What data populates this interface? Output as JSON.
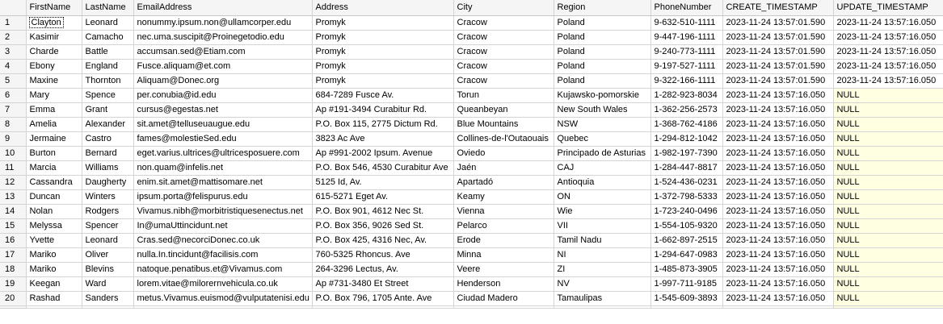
{
  "columns": [
    "",
    "FirstName",
    "LastName",
    "EmailAddress",
    "Address",
    "City",
    "Region",
    "PhoneNumber",
    "CREATE_TIMESTAMP",
    "UPDATE_TIMESTAMP"
  ],
  "rows": [
    [
      "1",
      "Clayton",
      "Leonard",
      "nonummy.ipsum.non@ullamcorper.edu",
      "Promyk",
      "Cracow",
      "Poland",
      "9-632-510-1111",
      "2023-11-24 13:57:01.590",
      "2023-11-24 13:57:16.050"
    ],
    [
      "2",
      "Kasimir",
      "Camacho",
      "nec.uma.suscipit@Proinegetodio.edu",
      "Promyk",
      "Cracow",
      "Poland",
      "9-447-196-1111",
      "2023-11-24 13:57:01.590",
      "2023-11-24 13:57:16.050"
    ],
    [
      "3",
      "Charde",
      "Battle",
      "accumsan.sed@Etiam.com",
      "Promyk",
      "Cracow",
      "Poland",
      "9-240-773-1111",
      "2023-11-24 13:57:01.590",
      "2023-11-24 13:57:16.050"
    ],
    [
      "4",
      "Ebony",
      "England",
      "Fusce.aliquam@et.com",
      "Promyk",
      "Cracow",
      "Poland",
      "9-197-527-1111",
      "2023-11-24 13:57:01.590",
      "2023-11-24 13:57:16.050"
    ],
    [
      "5",
      "Maxine",
      "Thornton",
      "Aliquam@Donec.org",
      "Promyk",
      "Cracow",
      "Poland",
      "9-322-166-1111",
      "2023-11-24 13:57:01.590",
      "2023-11-24 13:57:16.050"
    ],
    [
      "6",
      "Mary",
      "Spence",
      "per.conubia@id.edu",
      "684-7289 Fusce Av.",
      "Torun",
      "Kujawsko-pomorskie",
      "1-282-923-8034",
      "2023-11-24 13:57:16.050",
      "NULL"
    ],
    [
      "7",
      "Emma",
      "Grant",
      "cursus@egestas.net",
      "Ap #191-3494 Curabitur Rd.",
      "Queanbeyan",
      "New South Wales",
      "1-362-256-2573",
      "2023-11-24 13:57:16.050",
      "NULL"
    ],
    [
      "8",
      "Amelia",
      "Alexander",
      "sit.amet@telluseuaugue.edu",
      "P.O. Box 115, 2775 Dictum Rd.",
      "Blue Mountains",
      "NSW",
      "1-368-762-4186",
      "2023-11-24 13:57:16.050",
      "NULL"
    ],
    [
      "9",
      "Jermaine",
      "Castro",
      "fames@molestieSed.edu",
      "3823 Ac Ave",
      "Collines-de-l'Outaouais",
      "Quebec",
      "1-294-812-1042",
      "2023-11-24 13:57:16.050",
      "NULL"
    ],
    [
      "10",
      "Burton",
      "Bernard",
      "eget.varius.ultrices@ultricesposuere.com",
      "Ap #991-2002 Ipsum. Avenue",
      "Oviedo",
      "Principado de Asturias",
      "1-982-197-7390",
      "2023-11-24 13:57:16.050",
      "NULL"
    ],
    [
      "11",
      "Marcia",
      "Williams",
      "non.quam@infelis.net",
      "P.O. Box 546, 4530 Curabitur Ave",
      "Jaén",
      "CAJ",
      "1-284-447-8817",
      "2023-11-24 13:57:16.050",
      "NULL"
    ],
    [
      "12",
      "Cassandra",
      "Daugherty",
      "enim.sit.amet@mattisomare.net",
      "5125 Id, Av.",
      "Apartadó",
      "Antioquia",
      "1-524-436-0231",
      "2023-11-24 13:57:16.050",
      "NULL"
    ],
    [
      "13",
      "Duncan",
      "Winters",
      "ipsum.porta@felispurus.edu",
      "615-5271 Eget Av.",
      "Keamy",
      "ON",
      "1-372-798-5333",
      "2023-11-24 13:57:16.050",
      "NULL"
    ],
    [
      "14",
      "Nolan",
      "Rodgers",
      "Vivamus.nibh@morbitristiquesenectus.net",
      "P.O. Box 901, 4612 Nec St.",
      "Vienna",
      "Wie",
      "1-723-240-0496",
      "2023-11-24 13:57:16.050",
      "NULL"
    ],
    [
      "15",
      "Melyssa",
      "Spencer",
      "In@umaUttincidunt.net",
      "P.O. Box 356, 9026 Sed St.",
      "Pelarco",
      "VII",
      "1-554-105-9320",
      "2023-11-24 13:57:16.050",
      "NULL"
    ],
    [
      "16",
      "Yvette",
      "Leonard",
      "Cras.sed@necorciDonec.co.uk",
      "P.O. Box 425, 4316 Nec, Av.",
      "Erode",
      "Tamil Nadu",
      "1-662-897-2515",
      "2023-11-24 13:57:16.050",
      "NULL"
    ],
    [
      "17",
      "Mariko",
      "Oliver",
      "nulla.In.tincidunt@facilisis.com",
      "760-5325 Rhoncus. Ave",
      "Minna",
      "NI",
      "1-294-647-0983",
      "2023-11-24 13:57:16.050",
      "NULL"
    ],
    [
      "18",
      "Mariko",
      "Blevins",
      "natoque.penatibus.et@Vivamus.com",
      "264-3296 Lectus, Av.",
      "Veere",
      "ZI",
      "1-485-873-3905",
      "2023-11-24 13:57:16.050",
      "NULL"
    ],
    [
      "19",
      "Keegan",
      "Ward",
      "lorem.vitae@milorernvehicula.co.uk",
      "Ap #731-3480 Et Street",
      "Henderson",
      "NV",
      "1-997-711-9185",
      "2023-11-24 13:57:16.050",
      "NULL"
    ],
    [
      "20",
      "Rashad",
      "Sanders",
      "metus.Vivamus.euismod@vulputatenisi.edu",
      "P.O. Box 796, 1705 Ante. Ave",
      "Ciudad Madero",
      "Tamaulipas",
      "1-545-609-3893",
      "2023-11-24 13:57:16.050",
      "NULL"
    ]
  ],
  "colors": {
    "header_bg": "#f5f5f5",
    "null_bg": "#ffffe1",
    "grid_line": "#d4d4d4"
  }
}
